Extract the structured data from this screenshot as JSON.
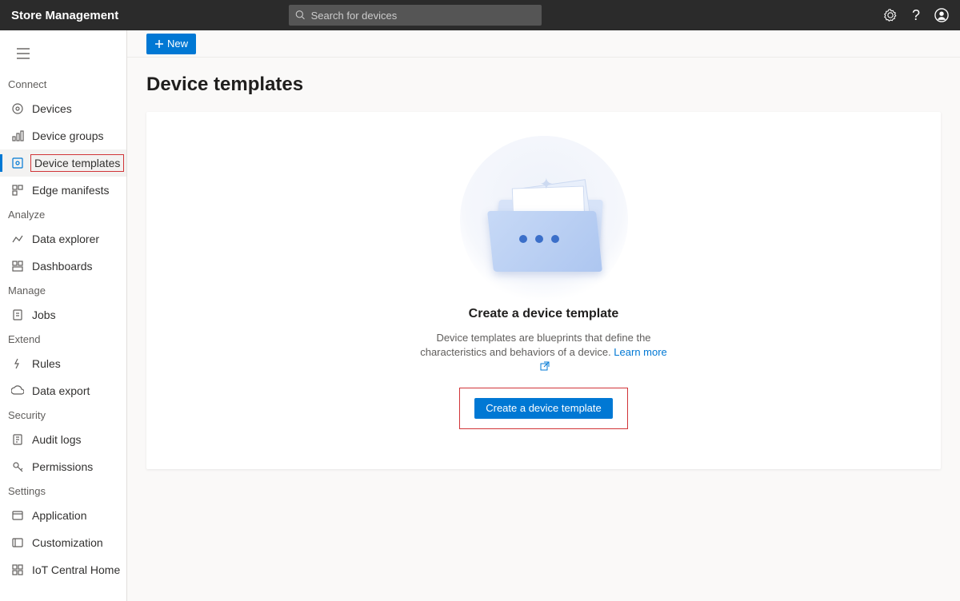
{
  "header": {
    "title": "Store Management",
    "search_placeholder": "Search for devices"
  },
  "toolbar": {
    "new_label": "New"
  },
  "page": {
    "title": "Device templates"
  },
  "sidebar": {
    "sections": [
      {
        "label": "Connect",
        "items": [
          {
            "label": "Devices"
          },
          {
            "label": "Device groups"
          },
          {
            "label": "Device templates",
            "active": true,
            "highlight": true
          },
          {
            "label": "Edge manifests"
          }
        ]
      },
      {
        "label": "Analyze",
        "items": [
          {
            "label": "Data explorer"
          },
          {
            "label": "Dashboards"
          }
        ]
      },
      {
        "label": "Manage",
        "items": [
          {
            "label": "Jobs"
          }
        ]
      },
      {
        "label": "Extend",
        "items": [
          {
            "label": "Rules"
          },
          {
            "label": "Data export"
          }
        ]
      },
      {
        "label": "Security",
        "items": [
          {
            "label": "Audit logs"
          },
          {
            "label": "Permissions"
          }
        ]
      },
      {
        "label": "Settings",
        "items": [
          {
            "label": "Application"
          },
          {
            "label": "Customization"
          },
          {
            "label": "IoT Central Home"
          }
        ]
      }
    ]
  },
  "empty": {
    "title": "Create a device template",
    "desc_prefix": "Device templates are blueprints that define the characteristics and behaviors of a device. ",
    "learn_more": "Learn more",
    "button": "Create a device template"
  }
}
